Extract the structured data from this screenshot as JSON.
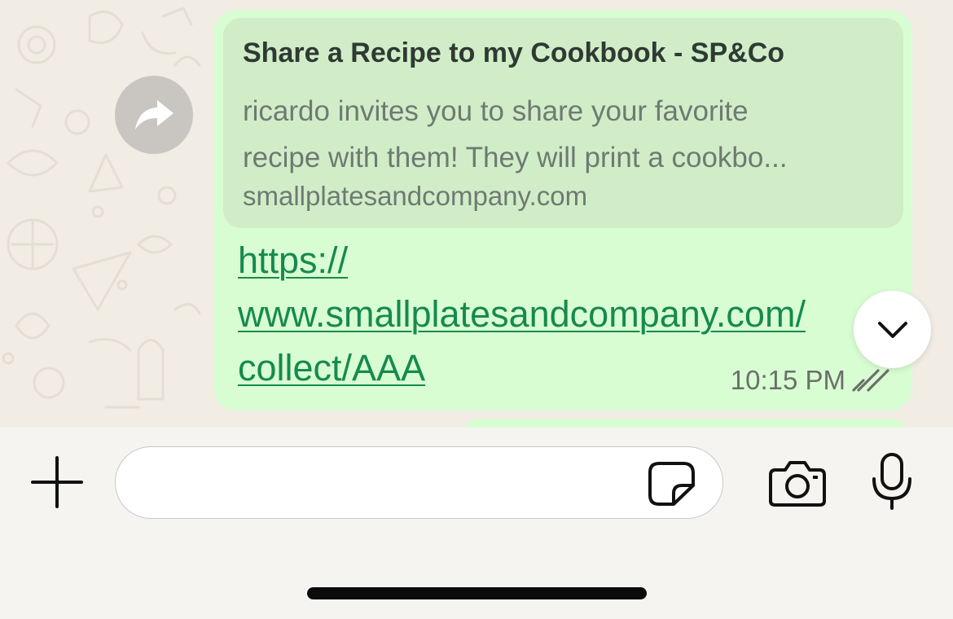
{
  "message": {
    "preview": {
      "title": "Share a Recipe to my Cookbook - SP&Co",
      "description_lines": [
        "ricardo invites you to share your favorite",
        "recipe with them! They will print a cookbo..."
      ],
      "domain": "smallplatesandcompany.com"
    },
    "link_lines": [
      "https://",
      "www.smallplatesandcompany.com/",
      "collect/AAA"
    ],
    "timestamp": "10:15 PM",
    "status_icon": "double-check-icon"
  },
  "icons": {
    "forward": "forward-arrow-icon",
    "scroll_down": "chevron-down-icon",
    "attach": "plus-icon",
    "sticker": "sticker-icon",
    "camera": "camera-icon",
    "microphone": "microphone-icon"
  },
  "composer": {
    "value": ""
  },
  "colors": {
    "bubble": "#d9fdd3",
    "link_preview": "#d0edc8",
    "link": "#168a4e",
    "chat_background": "#f1ece4"
  }
}
